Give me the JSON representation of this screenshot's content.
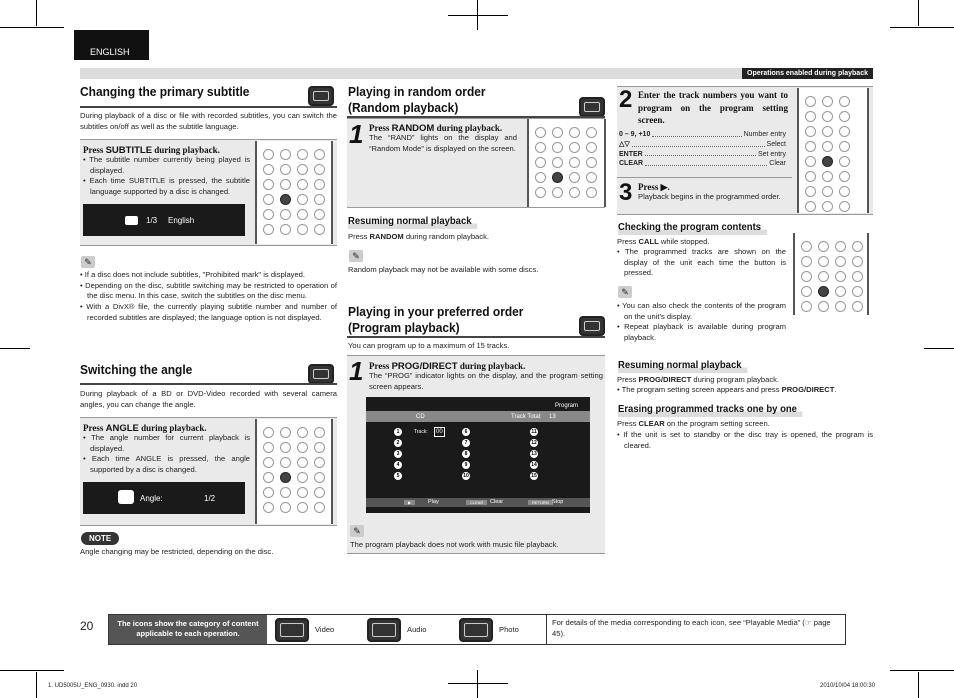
{
  "language_tab": "ENGLISH",
  "operations_label": "Operations enabled during playback",
  "col1": {
    "subtitle": {
      "title": "Changing the primary subtitle",
      "media_icon": "video-icon",
      "intro": "During playback of a disc or file with recorded subtitles, you can switch the subtitles on/off as well as the subtitle language.",
      "press_pre": "Press ",
      "press_key": "SUBTITLE",
      "press_post": " during playback.",
      "bullets": [
        "The subtitle number currently being played is displayed.",
        "Each time SUBTITLE is pressed, the subtitle language supported by a disc is changed."
      ],
      "screen_value": "1/3",
      "screen_lang": "English",
      "notes": [
        "If a disc does not include subtitles, \"Prohibited mark\" is displayed.",
        "Depending on the disc, subtitle switching may be restricted to operation of the disc menu. In this case, switch the subtitles on the disc menu.",
        "With a DivX® file, the currently playing subtitle number and number of recorded subtitles are displayed; the language option is not displayed."
      ]
    },
    "angle": {
      "title": "Switching the angle",
      "media_icon": "video-icon",
      "intro": "During playback of a BD or DVD-Video recorded with several camera angles, you can change the angle.",
      "press_pre": "Press ",
      "press_key": "ANGLE",
      "press_post": " during playback.",
      "bullets": [
        "The angle number for current playback is displayed.",
        "Each time ANGLE is pressed, the angle supported by a disc is changed."
      ],
      "screen_label": "Angle:",
      "screen_value": "1/2",
      "note_label": "NOTE",
      "note": "Angle changing may be restricted, depending on the disc."
    }
  },
  "col2": {
    "random": {
      "title1": "Playing in random order",
      "title2": "(Random playback)",
      "media_icon": "audio-icon",
      "step": "1",
      "press_pre": "Press ",
      "press_key": "RANDOM",
      "press_post": " during playback.",
      "desc": "The “RAND” lights on the display and “Random Mode” is displayed on the screen.",
      "resume_title": "Resuming normal playback",
      "resume_pre": "Press ",
      "resume_key": "RANDOM",
      "resume_post": " during random playback.",
      "note": "Random playback may not be available with some discs."
    },
    "program": {
      "title1": "Playing in your preferred order",
      "title2": "(Program playback)",
      "media_icon": "audio-icon",
      "intro": "You can program up to a maximum of 15 tracks.",
      "step": "1",
      "press_pre": "Press ",
      "press_key": "PROG/DIRECT",
      "press_post": " during playback.",
      "desc": "The “PROG” indicator lights on the display, and the program setting screen appears.",
      "screen": {
        "header": "Program",
        "source": "CD",
        "track_total_label": "Track Total:",
        "track_total": "13",
        "track_label": "Track:",
        "track_value": "00",
        "slots": [
          "1",
          "2",
          "3",
          "4",
          "5",
          "6",
          "7",
          "8",
          "9",
          "10",
          "11",
          "12",
          "13",
          "14",
          "15"
        ],
        "footer": [
          {
            "key": "▶",
            "label": "Play"
          },
          {
            "key": "CLEAR",
            "label": "Clear"
          },
          {
            "key": "RETURN",
            "label": "Stop"
          }
        ]
      },
      "note": "The program playback does not work with music file playback."
    }
  },
  "col3": {
    "step2": {
      "step": "2",
      "title": "Enter the track numbers you want to program on the program setting screen.",
      "keys": [
        {
          "key": "0 – 9, +10",
          "desc": "Number entry"
        },
        {
          "key": "△▽",
          "desc": "Select"
        },
        {
          "key": "ENTER",
          "desc": "Set entry"
        },
        {
          "key": "CLEAR",
          "desc": "Clear"
        }
      ]
    },
    "step3": {
      "step": "3",
      "press": "Press ▶.",
      "desc": "Playback begins in the programmed order."
    },
    "check": {
      "title": "Checking the program contents",
      "press_pre": "Press ",
      "press_key": "CALL",
      "press_post": " while stopped.",
      "bullet": "The programmed tracks are shown on the display of the unit each time the button is pressed.",
      "notes": [
        "You can also check the contents of the program on the unit’s display.",
        "Repeat playback is available during program playback."
      ]
    },
    "resume": {
      "title": "Resuming normal playback",
      "press_pre": "Press ",
      "press_key": "PROG/DIRECT",
      "press_post": " during program playback.",
      "bullet_pre": "The program setting screen appears and press ",
      "bullet_key": "PROG/DIRECT",
      "bullet_post": "."
    },
    "erase": {
      "title": "Erasing programmed tracks one by one",
      "press_pre": "Press ",
      "press_key": "CLEAR",
      "press_post": " on the program setting screen.",
      "bullet": "If the unit is set to standby or the disc tray is opened, the program is cleared."
    }
  },
  "footer": {
    "page_number": "20",
    "label": "The icons show the category of content applicable to each operation.",
    "icons": [
      {
        "icon": "video-icon",
        "label": "Video"
      },
      {
        "icon": "audio-icon",
        "label": "Audio"
      },
      {
        "icon": "photo-icon",
        "label": "Photo"
      }
    ],
    "ref_text": "For details of the media corresponding to each icon, see “Playable Media” (☞ page 45)."
  },
  "slug": {
    "file": "1. UD5005U_ENG_0930. indd   20",
    "date": "2010/10/04   18:00:30"
  }
}
